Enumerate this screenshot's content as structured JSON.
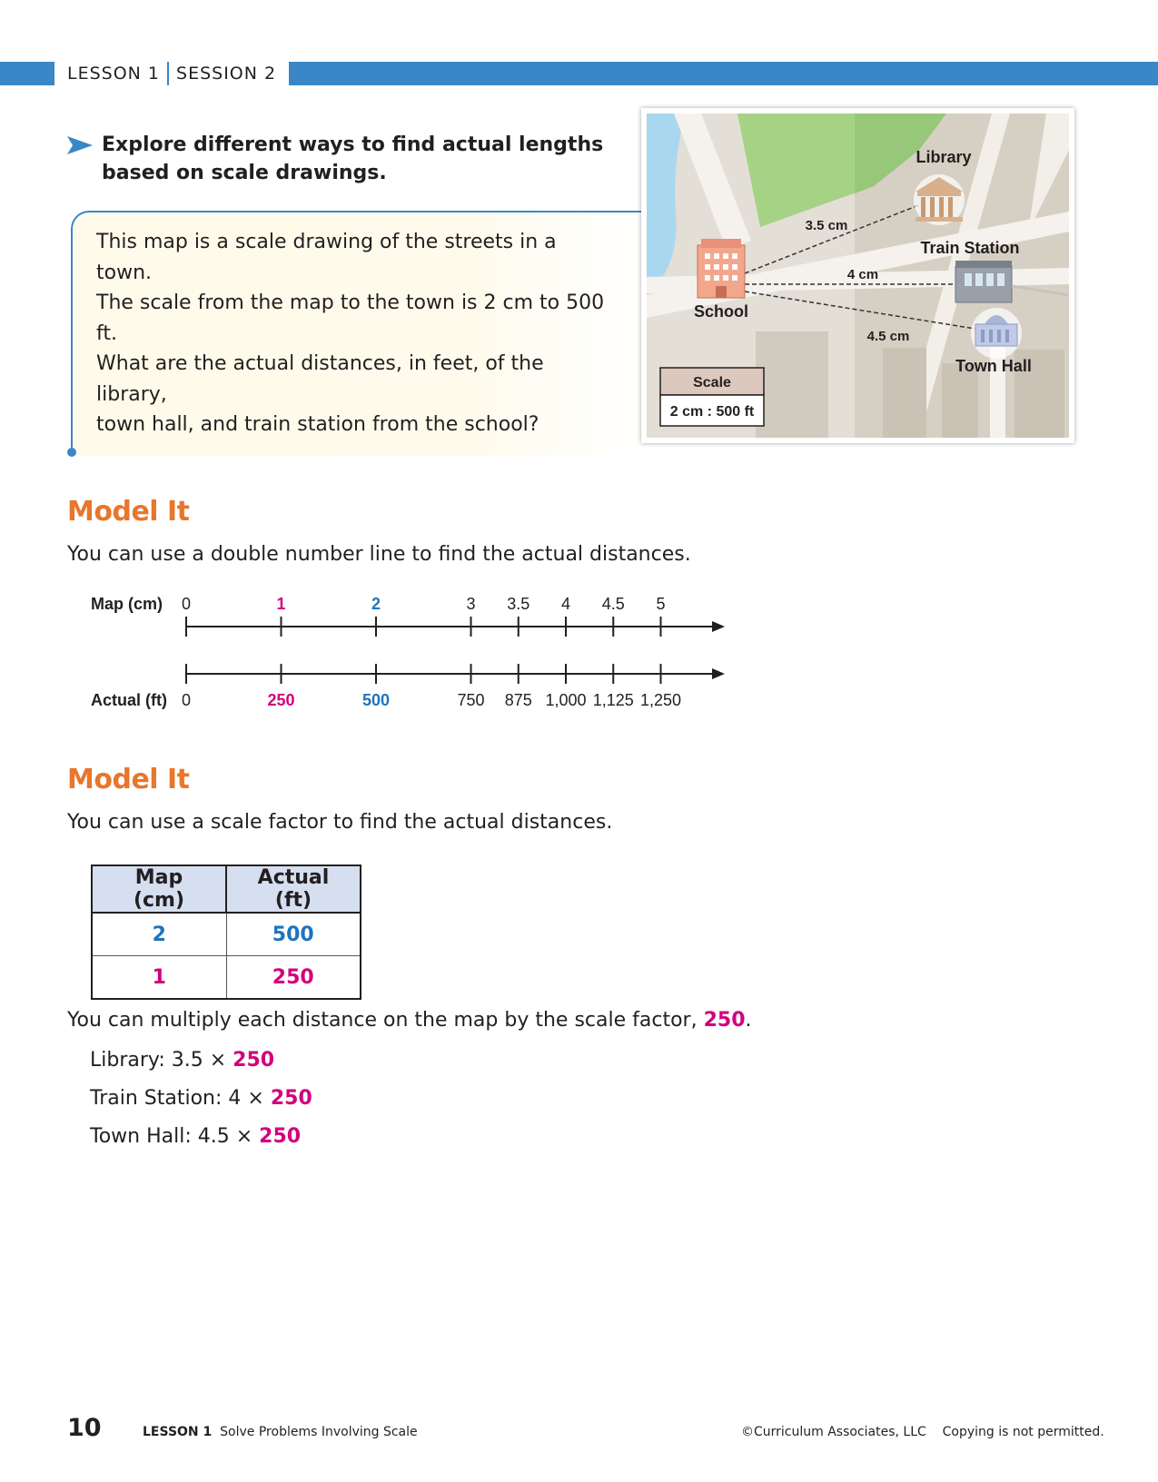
{
  "header": {
    "lesson": "LESSON 1",
    "session": "SESSION 2"
  },
  "explore": {
    "text": "Explore different ways to find actual lengths based on scale drawings."
  },
  "problem": {
    "line1": "This map is a scale drawing of the streets in a town.",
    "line2": "The scale from the map to the town is 2 cm to 500 ft.",
    "line3": "What are the actual distances, in feet, of the library,",
    "line4": "town hall, and train station from the school?"
  },
  "map": {
    "library": "Library",
    "train_station": "Train Station",
    "school": "School",
    "town_hall": "Town Hall",
    "dist_library": "3.5 cm",
    "dist_train": "4 cm",
    "dist_townhall": "4.5 cm",
    "scale_title": "Scale",
    "scale_value": "2 cm : 500 ft"
  },
  "model1": {
    "title": "Model It",
    "text": "You can use a double number line to find the actual distances.",
    "top_label": "Map (cm)",
    "bottom_label": "Actual (ft)",
    "top_ticks": [
      "0",
      "1",
      "2",
      "3",
      "3.5",
      "4",
      "4.5",
      "5"
    ],
    "bottom_ticks": [
      "0",
      "250",
      "500",
      "750",
      "875",
      "1,000",
      "1,125",
      "1,250"
    ]
  },
  "model2": {
    "title": "Model It",
    "text": "You can use a scale factor to find the actual distances.",
    "col1": "Map (cm)",
    "col2": "Actual (ft)",
    "rows": [
      [
        "2",
        "500"
      ],
      [
        "1",
        "250"
      ]
    ],
    "multiply_prefix": "You can multiply each distance on the map by the scale factor,",
    "scale_factor": "250",
    "period": ".",
    "library_prefix": "Library: 3.5",
    "train_prefix": "Train Station: 4",
    "townhall_prefix": "Town Hall: 4.5",
    "times_symbol": "×",
    "factor": "250"
  },
  "footer": {
    "page": "10",
    "lesson": "LESSON 1",
    "lesson_title": "Solve Problems Involving Scale",
    "copyright": "©Curriculum Associates, LLC",
    "notice": "Copying is not permitted."
  },
  "colors": {
    "brand_blue": "#3a87c8",
    "model_orange": "#e8762c",
    "value_blue": "#1e73be",
    "value_pink": "#d3007d"
  }
}
